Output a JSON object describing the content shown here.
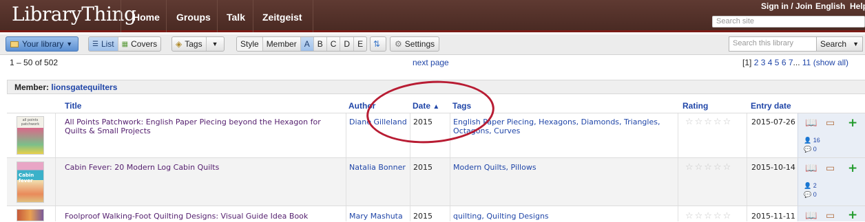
{
  "brand": {
    "logo": "LibraryThing"
  },
  "nav": {
    "items": [
      "Home",
      "Groups",
      "Talk",
      "Zeitgeist"
    ]
  },
  "top_links": {
    "signin": "Sign in / Join",
    "english": "English",
    "help": "Help"
  },
  "site_search": {
    "placeholder": "Search site"
  },
  "toolbar": {
    "your_library": "Your library",
    "list": "List",
    "covers": "Covers",
    "tags": "Tags",
    "style": "Style",
    "member": "Member",
    "letters": [
      "A",
      "B",
      "C",
      "D",
      "E"
    ],
    "settings": "Settings",
    "search_placeholder": "Search this library",
    "search_button": "Search"
  },
  "paging": {
    "range": "1 – 50 of 502",
    "next": "next page",
    "current": "[1]",
    "pages": [
      "2",
      "3",
      "4",
      "5",
      "6",
      "7"
    ],
    "ellipsis": "...",
    "last": "11",
    "show_all": "(show all)"
  },
  "member": {
    "label": "Member:",
    "name": "lionsgatequilters"
  },
  "columns": {
    "title": "Title",
    "author": "Author",
    "date": "Date",
    "sort_arrow": "▲",
    "tags": "Tags",
    "rating": "Rating",
    "entry_date": "Entry date"
  },
  "books": [
    {
      "title": "All Points Patchwork: English Paper Piecing beyond the Hexagon for Quilts & Small Projects",
      "author": "Diane Gilleland",
      "date": "2015",
      "tags": "English Paper Piecing, Hexagons, Diamonds, Triangles, Octagons, Curves",
      "entry_date": "2015-07-26",
      "members": "16",
      "reviews": "0",
      "cover_text": "all points patchwork",
      "cover_color": "#d96a8a"
    },
    {
      "title": "Cabin Fever: 20 Modern Log Cabin Quilts",
      "author": "Natalia Bonner",
      "date": "2015",
      "tags": "Modern Quilts, Pillows",
      "entry_date": "2015-10-14",
      "members": "2",
      "reviews": "0",
      "cover_text": "Cabin fever",
      "cover_color": "#3bb1c9"
    },
    {
      "title": "Foolproof Walking-Foot Quilting Designs: Visual Guide Idea Book",
      "author": "Mary Mashuta",
      "date": "2015",
      "tags": "quilting, Quilting Designs",
      "entry_date": "2015-11-11",
      "members": "",
      "reviews": "",
      "cover_text": "",
      "cover_color": "#c65a3a"
    }
  ],
  "colors": {
    "header_bg": "#4a2a23",
    "accent_red": "#b81c33",
    "link": "#2046a8"
  }
}
